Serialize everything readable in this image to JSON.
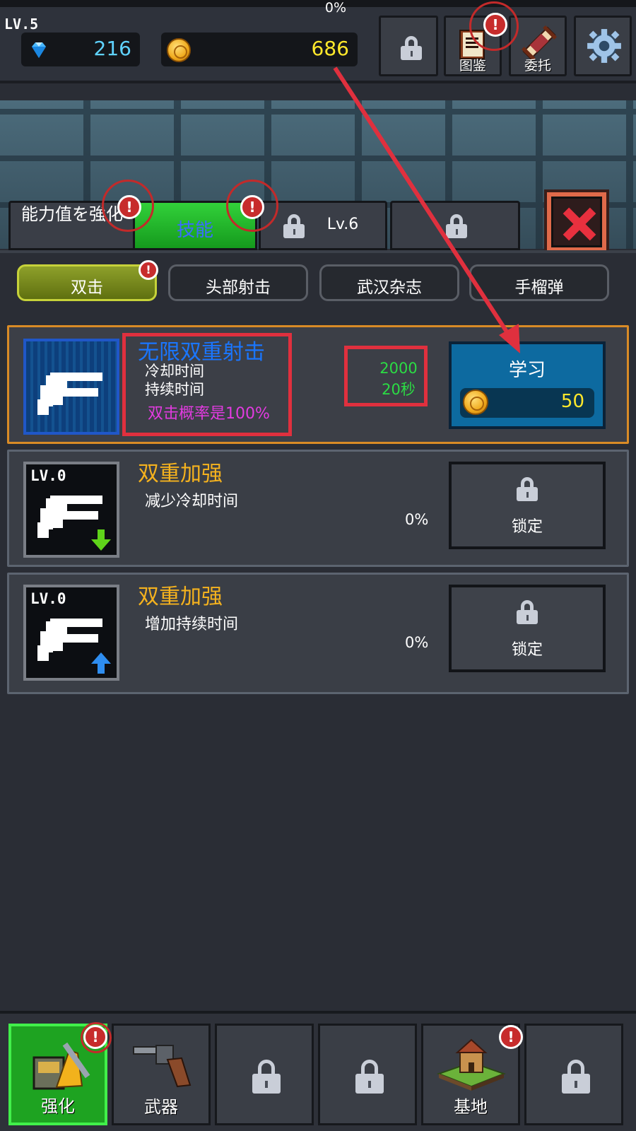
{
  "header": {
    "xp_percent_text": "0%",
    "level": "LV.5",
    "gems": "216",
    "coins": "686",
    "codex_label": "图鉴",
    "commission_label": "委托"
  },
  "tabs": [
    {
      "label": "能力值を強化"
    },
    {
      "label": "技能",
      "active": true
    },
    {
      "label": "Lv.6",
      "locked": true
    },
    {
      "label": "",
      "locked": true
    }
  ],
  "subtabs": [
    {
      "label": "双击",
      "active": true
    },
    {
      "label": "头部射击"
    },
    {
      "label": "武汉杂志"
    },
    {
      "label": "手榴弹"
    }
  ],
  "main_skill": {
    "title": "无限双重射击",
    "lines": [
      "冷却时间",
      "持续时间"
    ],
    "stats": [
      "2000",
      "20秒"
    ],
    "description": "双击概率是100%",
    "learn_label": "学习",
    "cost": "50"
  },
  "sub_skills": [
    {
      "level": "LV.0",
      "title": "双重加强",
      "description": "减少冷却时间",
      "percent": "0%",
      "lock_label": "锁定",
      "arrow": "down"
    },
    {
      "level": "LV.0",
      "title": "双重加强",
      "description": "增加持续时间",
      "percent": "0%",
      "lock_label": "锁定",
      "arrow": "up"
    }
  ],
  "bottom_nav": [
    {
      "label": "强化",
      "icon": "enhance-icon",
      "active": true
    },
    {
      "label": "武器",
      "icon": "revolver-icon"
    },
    {
      "label": "",
      "icon": "lock-icon"
    },
    {
      "label": "",
      "icon": "lock-icon"
    },
    {
      "label": "基地",
      "icon": "base-icon"
    },
    {
      "label": "",
      "icon": "lock-icon"
    }
  ],
  "badge_symbol": "!",
  "colors": {
    "accent_green": "#1ea321",
    "active_tab_text": "#3b6cff",
    "skill_title_blue": "#1a76ff",
    "gold_text": "#f5b21e",
    "stat_green": "#2bdc44",
    "desc_magenta": "#e23be0",
    "annotation_red": "#e0303e"
  }
}
